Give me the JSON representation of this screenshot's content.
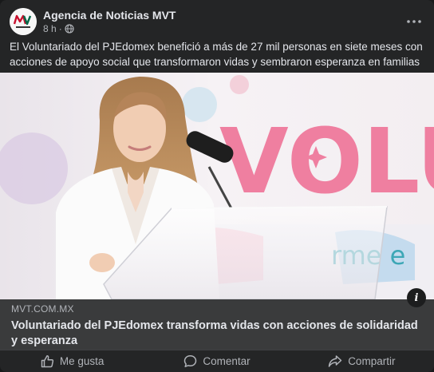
{
  "post": {
    "author": "Agencia de Noticias MVT",
    "time": "8 h",
    "audience_icon": "globe-icon",
    "text": "El Voluntariado del PJEdomex benefició a más de 27 mil personas en siete meses con acciones de apoyo social que transformaron vidas y sembraron esperanza en familias mexiquenses."
  },
  "avatar": {
    "logo_text": "MVT"
  },
  "image": {
    "banner_word": "VOLU",
    "banner_sub": "rme e",
    "description": "Woman in white blazer speaking at a clear podium in front of a pink 'Voluntariado' banner"
  },
  "link": {
    "domain": "MVT.COM.MX",
    "headline": "Voluntariado del PJEdomex transforma vidas con acciones de solidaridad y esperanza",
    "info_label": "i"
  },
  "actions": {
    "like": "Me gusta",
    "comment": "Comentar",
    "share": "Compartir"
  },
  "colors": {
    "background": "#242526",
    "link_box": "#3a3b3c",
    "text_primary": "#e4e6eb",
    "text_secondary": "#b0b3b8",
    "banner_pink": "#ef7fa0"
  }
}
